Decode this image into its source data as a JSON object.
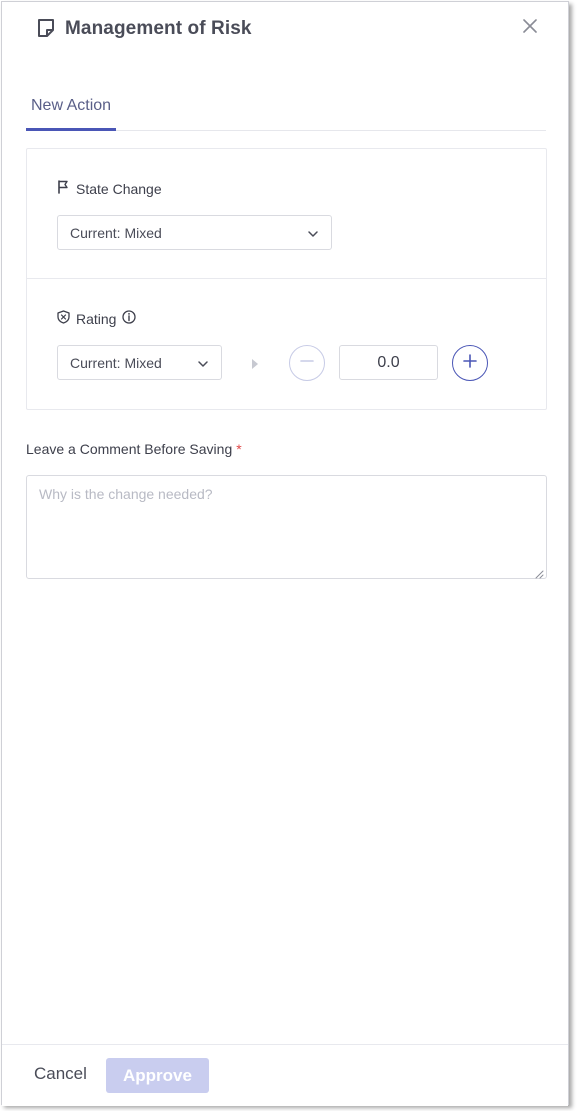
{
  "header": {
    "title": "Management of Risk",
    "title_icon": "note-icon",
    "close_icon": "close-icon"
  },
  "tabs": [
    {
      "label": "New Action",
      "active": true
    }
  ],
  "state_change": {
    "label": "State Change",
    "icon": "flag-icon",
    "select_value": "Current: Mixed"
  },
  "rating": {
    "label": "Rating",
    "icon": "shield-icon",
    "info_icon": "info-icon",
    "select_value": "Current: Mixed",
    "value": "0.0"
  },
  "comment": {
    "label": "Leave a Comment Before Saving",
    "required_mark": "*",
    "placeholder": "Why is the change needed?",
    "value": ""
  },
  "footer": {
    "cancel_label": "Cancel",
    "approve_label": "Approve"
  },
  "colors": {
    "accent": "#4a56b6",
    "approve_disabled_bg": "#c9cdef",
    "required": "#e04848"
  }
}
